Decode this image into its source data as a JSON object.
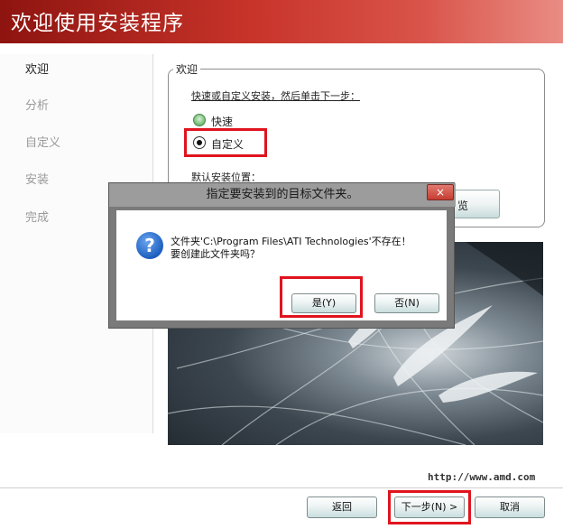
{
  "header": {
    "title": "欢迎使用安装程序"
  },
  "sidebar": {
    "items": [
      {
        "label": "欢迎",
        "active": true
      },
      {
        "label": "分析",
        "active": false
      },
      {
        "label": "自定义",
        "active": false
      },
      {
        "label": "安装",
        "active": false
      },
      {
        "label": "完成",
        "active": false
      }
    ]
  },
  "welcome_group": {
    "legend": "欢迎",
    "instruction": "快速或自定义安装，然后单击下一步：",
    "options": [
      {
        "label": "快速",
        "selected": false
      },
      {
        "label": "自定义",
        "selected": true
      }
    ],
    "default_location_label": "默认安装位置：",
    "browse_label_visible": "览"
  },
  "footer": {
    "url": "http://www.amd.com",
    "back_label": "返回",
    "next_label": "下一步(N) >",
    "cancel_label": "取消"
  },
  "dialog": {
    "title": "指定要安装到的目标文件夹。",
    "close_glyph": "×",
    "icon": "question-icon",
    "icon_glyph": "?",
    "message_line1": "文件夹'C:\\Program Files\\ATI Technologies'不存在！",
    "message_line2": "要创建此文件夹吗？",
    "yes_label": "是(Y)",
    "no_label": "否(N)"
  },
  "colors": {
    "highlight_red": "#e0141e",
    "header_red": "#c8342a"
  }
}
